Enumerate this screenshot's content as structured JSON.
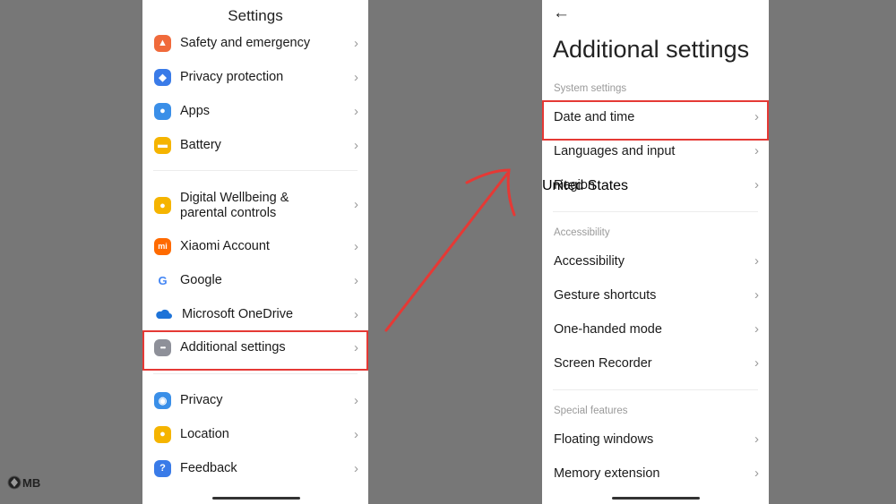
{
  "left_screen": {
    "title": "Settings",
    "items": [
      {
        "label": "Safety and emergency",
        "icon": "alarm-icon",
        "color": "#f06a3b"
      },
      {
        "label": "Privacy protection",
        "icon": "shield-icon",
        "color": "#3a7be8"
      },
      {
        "label": "Apps",
        "icon": "gear-icon",
        "color": "#3a8fe8"
      },
      {
        "label": "Battery",
        "icon": "battery-icon",
        "color": "#f5b400"
      },
      {
        "label": "Digital Wellbeing &\nparental controls",
        "icon": "wellbeing-icon",
        "color": "#f5b400"
      },
      {
        "label": "Xiaomi Account",
        "icon": "mi-icon",
        "color": "#ff6a00",
        "glyph": "mi"
      },
      {
        "label": "Google",
        "icon": "google-icon",
        "color": "#ffffff",
        "glyph": "G"
      },
      {
        "label": "Microsoft OneDrive",
        "icon": "onedrive-icon",
        "color": "#1e73d8"
      },
      {
        "label": "Additional settings",
        "icon": "more-icon",
        "color": "#8e9099"
      },
      {
        "label": "Privacy",
        "icon": "eye-icon",
        "color": "#3a8fe8"
      },
      {
        "label": "Location",
        "icon": "location-icon",
        "color": "#f5b400"
      },
      {
        "label": "Feedback",
        "icon": "feedback-icon",
        "color": "#3a7be8",
        "glyph": "?"
      }
    ]
  },
  "right_screen": {
    "back_icon": "←",
    "title": "Additional settings",
    "sections": [
      {
        "header": "System settings",
        "items": [
          {
            "label": "Date and time",
            "value": ""
          },
          {
            "label": "Languages and input",
            "value": ""
          },
          {
            "label": "Region",
            "value": "United States"
          }
        ]
      },
      {
        "header": "Accessibility",
        "items": [
          {
            "label": "Accessibility",
            "value": ""
          },
          {
            "label": "Gesture shortcuts",
            "value": ""
          },
          {
            "label": "One-handed mode",
            "value": ""
          },
          {
            "label": "Screen Recorder",
            "value": ""
          }
        ]
      },
      {
        "header": "Special features",
        "items": [
          {
            "label": "Floating windows",
            "value": ""
          },
          {
            "label": "Memory extension",
            "value": ""
          }
        ]
      }
    ]
  },
  "chevron": "›",
  "highlight_color": "#e53935",
  "watermark": "MB"
}
